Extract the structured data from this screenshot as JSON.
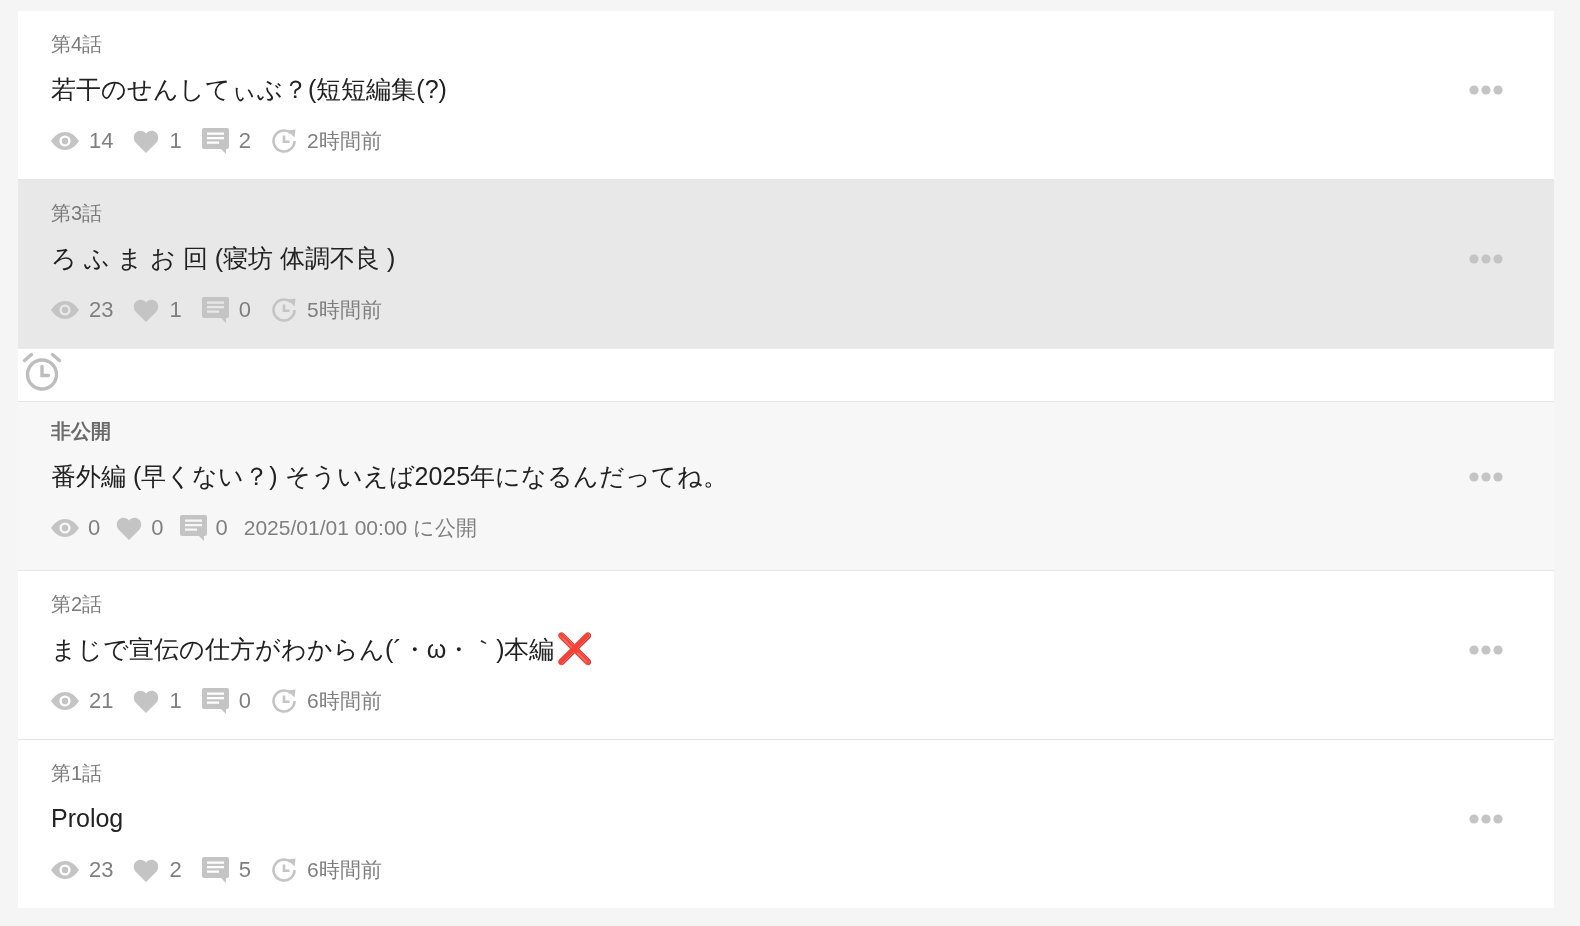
{
  "episodes": [
    {
      "kind": "published",
      "label": "第4話",
      "title": "若干のせんしてぃぶ？(短短編集(?)",
      "views": "14",
      "likes": "1",
      "comments": "2",
      "time": "2時間前",
      "selected": false
    },
    {
      "kind": "published",
      "label": "第3話",
      "title": "ろ ふ ま お 回 (寝坊 体調不良 )",
      "views": "23",
      "likes": "1",
      "comments": "0",
      "time": "5時間前",
      "selected": true
    },
    {
      "kind": "scheduled",
      "label": "非公開",
      "title": "番外編 (早くない？) そういえば2025年になるんだってね。",
      "views": "0",
      "likes": "0",
      "comments": "0",
      "time": "2025/01/01 00:00 に公開",
      "selected": false
    },
    {
      "kind": "published",
      "label": "第2話",
      "title": "まじで宣伝の仕方がわからん(´・ω・｀)本編",
      "emoji": "❌",
      "views": "21",
      "likes": "1",
      "comments": "0",
      "time": "6時間前",
      "selected": false
    },
    {
      "kind": "published",
      "label": "第1話",
      "title": "Prolog",
      "views": "23",
      "likes": "2",
      "comments": "5",
      "time": "6時間前",
      "selected": false
    }
  ]
}
